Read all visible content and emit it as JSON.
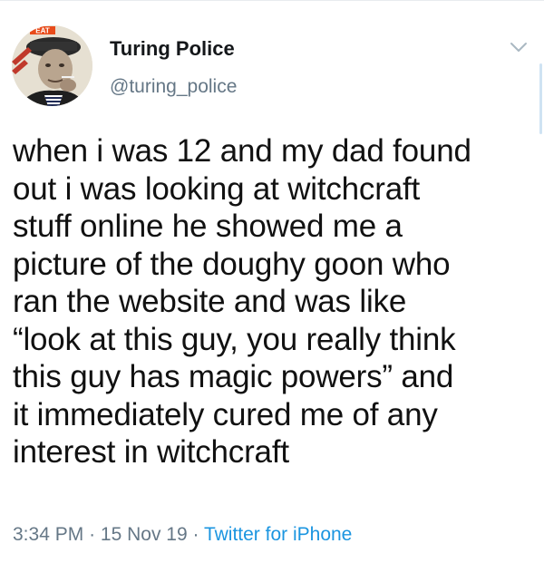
{
  "tweet": {
    "author": {
      "display_name": "Turing Police",
      "handle": "@turing_police",
      "avatar_badge_text": "EAT",
      "avatar_icon": "profile-photo"
    },
    "text": "when i was 12 and my dad found\nout i was looking at witchcraft\nstuff online he showed me a\npicture of the doughy goon who\nran the website and was like\n“look at this guy, you really think\nthis guy has magic powers” and\nit immediately cured me of any\ninterest in witchcraft",
    "time": "3:34 PM",
    "separator": "·",
    "date": "15 Nov 19",
    "source": "Twitter for iPhone",
    "menu_icon": "chevron-down-icon"
  },
  "colors": {
    "text": "#111111",
    "secondary": "#657786",
    "link": "#1b95e0",
    "background": "#ffffff"
  }
}
